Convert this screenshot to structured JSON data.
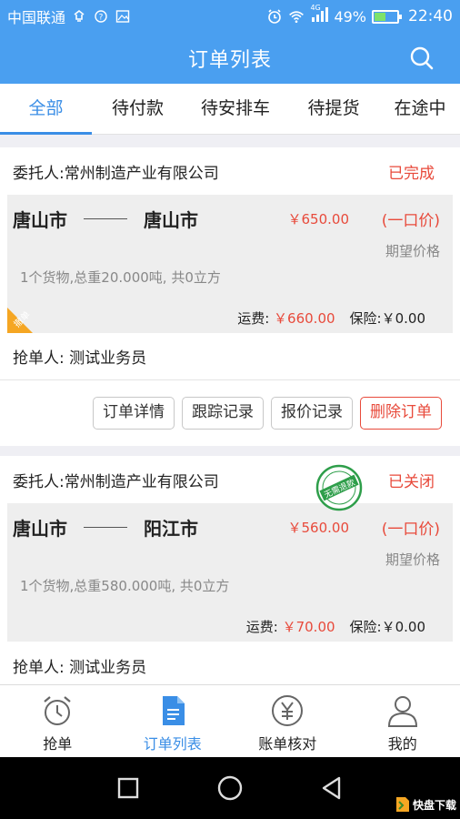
{
  "statusbar": {
    "carrier": "中国联通",
    "network": "4G",
    "battery": "49%",
    "battery_level": 0.49,
    "time": "22:40"
  },
  "appbar": {
    "title": "订单列表",
    "search_icon": "search-icon"
  },
  "tabs": [
    {
      "label": "全部",
      "active": true
    },
    {
      "label": "待付款"
    },
    {
      "label": "待安排车"
    },
    {
      "label": "待提货"
    },
    {
      "label": "在途中"
    }
  ],
  "orders": [
    {
      "consignor": "委托人:常州制造产业有限公司",
      "status": "已完成",
      "from": "唐山市",
      "to": "唐山市",
      "price": "￥650.00",
      "price_type": "(一口价)",
      "expect_label": "期望价格",
      "goods": "1个货物,总重20.000吨, 共0立方",
      "freight_label": "运费: ",
      "freight_value": "￥660.00",
      "insurance": "保险:￥0.00",
      "corner_tag": "撤单",
      "grabber": "抢单人: 测试业务员",
      "actions": [
        "订单详情",
        "跟踪记录",
        "报价记录",
        "删除订单"
      ]
    },
    {
      "consignor": "委托人:常州制造产业有限公司",
      "status": "已关闭",
      "from": "唐山市",
      "to": "阳江市",
      "price": "￥560.00",
      "price_type": "(一口价)",
      "expect_label": "期望价格",
      "goods": "1个货物,总重580.000吨, 共0立方",
      "freight_label": "运费: ",
      "freight_value": "￥70.00",
      "insurance": "保险:￥0.00",
      "stamp_text": "无需退款",
      "grabber": "抢单人: 测试业务员"
    }
  ],
  "bottom_nav": [
    {
      "label": "抢单",
      "icon": "alarm-clock-icon"
    },
    {
      "label": "订单列表",
      "icon": "document-icon",
      "active": true
    },
    {
      "label": "账单核对",
      "icon": "yen-icon"
    },
    {
      "label": "我的",
      "icon": "user-icon"
    }
  ],
  "watermark": "快盘下载",
  "colors": {
    "primary": "#4a9ff0",
    "active": "#3a8ee6",
    "danger": "#e84a3b"
  }
}
